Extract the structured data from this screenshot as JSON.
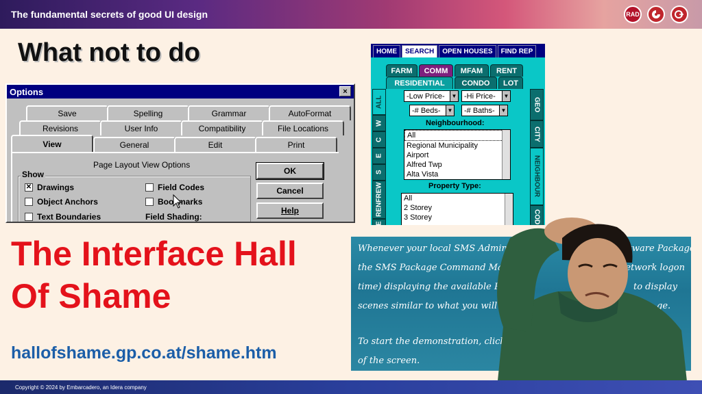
{
  "header": {
    "title": "The fundamental secrets of good UI design",
    "logo_rad": "RAD"
  },
  "heading": "What not to do",
  "options_dialog": {
    "title": "Options",
    "close": "×",
    "tabs_row1": [
      "Save",
      "Spelling",
      "Grammar",
      "AutoFormat"
    ],
    "tabs_row2": [
      "Revisions",
      "User Info",
      "Compatibility",
      "File Locations"
    ],
    "tabs_row3": [
      "View",
      "General",
      "Edit",
      "Print"
    ],
    "page_layout_title": "Page Layout View Options",
    "show_label": "Show",
    "checks": [
      {
        "label": "Drawings",
        "checked": true
      },
      {
        "label": "Object Anchors",
        "checked": false
      },
      {
        "label": "Text Boundaries",
        "checked": false
      },
      {
        "label": "Field Codes",
        "checked": false
      },
      {
        "label": "Bookmarks",
        "checked": false
      }
    ],
    "field_shading": "Field Shading:",
    "buttons": {
      "ok": "OK",
      "cancel": "Cancel",
      "help": "Help"
    }
  },
  "mls_panel": {
    "top_tabs": [
      "HOME",
      "SEARCH",
      "OPEN HOUSES",
      "FIND REP"
    ],
    "type_tabs": [
      "FARM",
      "COMM",
      "MFAM",
      "RENT"
    ],
    "sub_tabs": [
      "RESIDENTIAL",
      "CONDO",
      "LOT"
    ],
    "left_vtabs": [
      "ALL",
      "W",
      "C",
      "E",
      "S",
      "RENFREW",
      "E"
    ],
    "right_vtabs": [
      "GEO",
      "CITY",
      "NEIGHBOUR",
      "COD"
    ],
    "low_price": "-Low Price-",
    "hi_price": "-Hi Price-",
    "beds": "-# Beds-",
    "baths": "-# Baths-",
    "neighbourhood_label": "Neighbourhood:",
    "neighbourhoods": [
      "All",
      "Regional Municipality",
      "Airport",
      "Alfred Twp",
      "Alta Vista"
    ],
    "property_type_label": "Property Type:",
    "property_types": [
      "All",
      "2 Storey",
      "3 Storey"
    ]
  },
  "shame": {
    "line1": "The Interface Hall",
    "line2": "Of Shame",
    "url": "hallofshame.gp.co.at/shame.htm"
  },
  "sms_slide": {
    "lines": [
      "Whenever your local SMS Administrato",
      "the SMS Package Command Man",
      "time) displaying the available P",
      "scenes similar to what you will se",
      "To start the demonstration, click the \"",
      "of the screen."
    ],
    "right_lines": [
      "oftware Package,",
      "network logon",
      "to display",
      "ge."
    ]
  },
  "footer": {
    "copyright": "Copyright © 2024  by Embarcadero, an Idera company"
  }
}
